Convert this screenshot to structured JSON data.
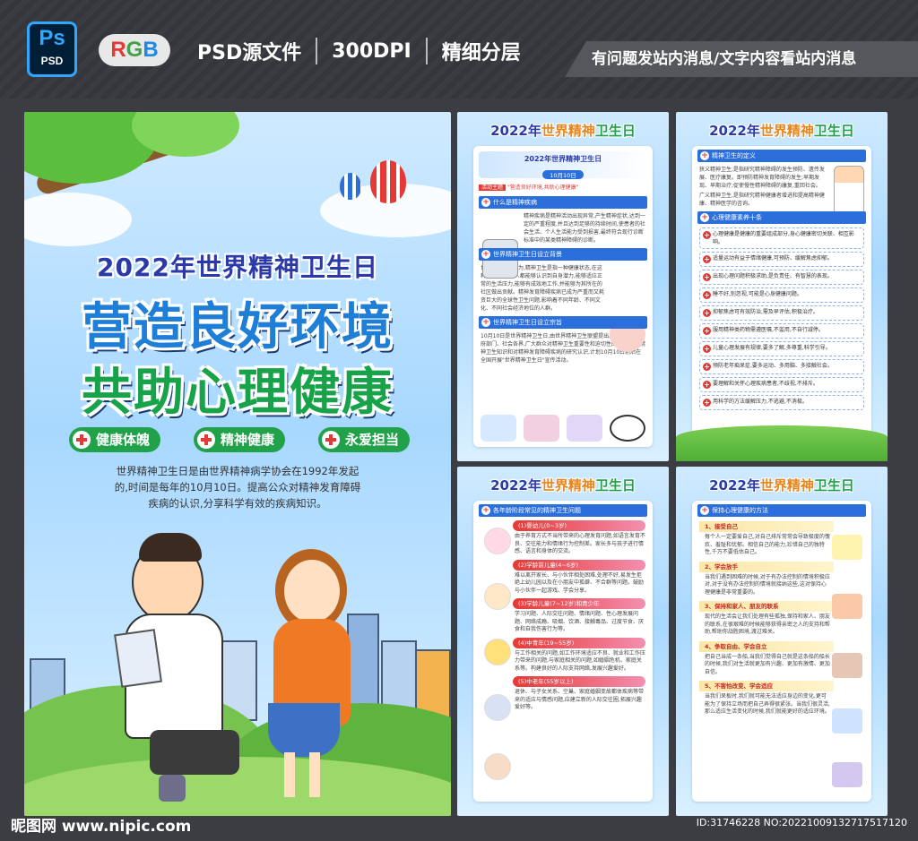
{
  "header": {
    "ps_label": "Ps",
    "psd_label": "PSD",
    "rgb_r": "R",
    "rgb_g": "G",
    "rgb_b": "B",
    "meta": [
      "PSD源文件",
      "300DPI",
      "精细分层"
    ],
    "notice": "有问题发站内消息/文字内容看站内消息"
  },
  "main_poster": {
    "title_year": "2022年世界精神卫生日",
    "slogan_1": "营造良好环境",
    "slogan_2": "共助心理健康",
    "tags": [
      "健康体魄",
      "精神健康",
      "永爱担当"
    ],
    "intro": "世界精神卫生日是由世界精神病学协会在1992年发起的,时间是每年的10月10日。提高公众对精神发育障碍疾病的认识,分享科学有效的疾病知识。"
  },
  "poster_1": {
    "title": {
      "a": "2022年",
      "b": "世界精神",
      "c": "卫生日"
    },
    "banner_title": "2022年世界精神卫生日",
    "banner_date": "10月10日",
    "theme_label": "活动主题",
    "theme_text": "\"营造良好环境,共助心理健康\"",
    "sec_1": "什么是精神疾病",
    "sec_1_text": "精神疾病是精神活动出现异常,产生精神症状,达到一定的严重程度,并且达到足够的持续时间,使患者的社会生活、个人生活能力受到损害,最终符合现行诊断标准中的某类精神障碍的诊断。",
    "sec_2": "世界精神卫生日设立背景",
    "sec_2_text": "世界卫生组织认为,精神卫生是指一种健康状态,在这种状态中,每个人都能够认识到自身潜力,能够适应正常的生活压力,能够有成效地工作,并能够为其所在的社区做出贡献。精神发育障碍疾病已成为严重而又耗资巨大的全球性卫生问题,影响着不同年龄、不同文化、不同社会经济地位的人群。",
    "sec_3": "世界精神卫生日设立宗旨",
    "sec_3_text": "10月10日是世界精神卫生日,由世界精神卫生联盟提出。为了提高政府部门、社会各界,广大群众对精神卫生重要性和迫切性的认识,普及精神卫生知识和对精神发育障碍疾病的研究认识,计划10月10日前后在全国开展\"世界精神卫生日\"宣传活动。"
  },
  "poster_2": {
    "title": {
      "a": "2022年",
      "b": "世界精神",
      "c": "卫生日"
    },
    "sec_1": "精神卫生的定义",
    "sec_1_text_a": "狭义精神卫生,是指研究精神障碍的发生预防、遗传发展、医疗康复。即预防精神发育障碍的发生;早期发现、早期治疗;促使慢性精神障碍的康复,重回社会。",
    "sec_1_text_b": "广义精神卫生,是指研究精神健康者增进和提高精神健康、精神医学的咨询。",
    "sec_2": "心理健康素养十条",
    "items": [
      "心理健康是健康的重要组成部分,身心健康密切关联、相互影响。",
      "适量运动有益于情绪健康,可预防、缓解焦虑抑郁。",
      "出现心理问题积极求助,是负责任、有智慧的表现。",
      "睡不好,别忽视,可能是心身健康问题。",
      "抑郁焦虑可有效防治,需及早评估,积极治疗。",
      "服用精神类药物需遵医嘱,不滥用,不自行减停。",
      "儿童心理发展有规律,要多了解,多尊重,科学引导。",
      "预防老年痴呆症,要多运动、多用脑、多接触社会。",
      "要理解和关怀心理疾病患者,不歧视,不排斥。",
      "用科学的方法缓解压力,不逃避,不消极。"
    ]
  },
  "poster_3": {
    "title": {
      "a": "2022年",
      "b": "世界精神",
      "c": "卫生日"
    },
    "sec_1": "各年龄阶段常见的精神卫生问题",
    "ages": [
      {
        "head": "(1)婴幼儿(0~3岁)",
        "text": "由于养育方式不当所带来的心理发育问题,如语言发育不良、交往能力和情绪行为控制差。家长多与孩子进行情感、语言和身体的交流。"
      },
      {
        "head": "(2)学龄前儿童(4~6岁)",
        "text": "难以离开家长、与小伙伴相处困难,处理不好,易发生拒绝上幼儿园以及在小朋友中孤僻、不合群等问题。鼓励与小伙伴一起游戏、学会分享。"
      },
      {
        "head": "(3)学龄儿童(7~12岁)和青少年",
        "text": "学习问题、人际交往问题、情绪问题、性心理发展问题、网络成瘾、吸烟、饮酒、接触毒品、过度节食、厌食和自我伤害行为等。"
      },
      {
        "head": "(4)中青年(19~55岁)",
        "text": "与工作相关的问题,如工作环境适应不良、就业和工作压力带来的问题;与家庭相关的问题,如婚姻危机、家庭关系等。构建良好的人际支持网络,发展兴趣爱好。"
      },
      {
        "head": "(5)中老年(55岁以上)",
        "text": "退休、与子女关系、空巢、家庭婚姻变故都体疾病等带来的适应与情感问题,应建立新的人际交往圈,拓展兴趣爱好等。"
      }
    ]
  },
  "poster_4": {
    "title": {
      "a": "2022年",
      "b": "世界精神",
      "c": "卫生日"
    },
    "sec_1": "保持心理健康的方法",
    "tips": [
      {
        "head": "1、接受自己",
        "text": "每个人一定要爱自己,对自己排斥常常会导致极度的愧疚、羞耻和忧郁。相信自己的能力,珍惜自己的独特性,千万不要低估自己。"
      },
      {
        "head": "2、学会放手",
        "text": "当我们遇到困难的时候,对于有办法控制的情境积极应对,对于没有办法控制的情境就接纳这些,这对保持心理健康是非常重要的。"
      },
      {
        "head": "3、保持和家人、朋友的联系",
        "text": "现代的生活会让我们处理有些孤独,保持和家人、朋友的联系,在很艰难的时候能够获得亲密之人的支持和帮助,帮助你战胜困境,渡过难关。"
      },
      {
        "head": "4、争取自由、学会自立",
        "text": "把自己当成一条船,当我们觉得自己就是这条船的船长的时候,我们对生活就更加有兴趣、更加有激情、更加自信。"
      },
      {
        "head": "5、不害怕改变、学会适应",
        "text": "当我们呆板时,我们就可能无法适应身边的变化,更可能为了保持立场而把自己弄得很紧张。当我们很灵活,那么适应生活变化的时候,我们就能更好的适应环境。"
      }
    ]
  },
  "footer": {
    "site": "昵图网 www.nipic.com",
    "id": "ID:31746228 NO:20221009132717517120"
  }
}
